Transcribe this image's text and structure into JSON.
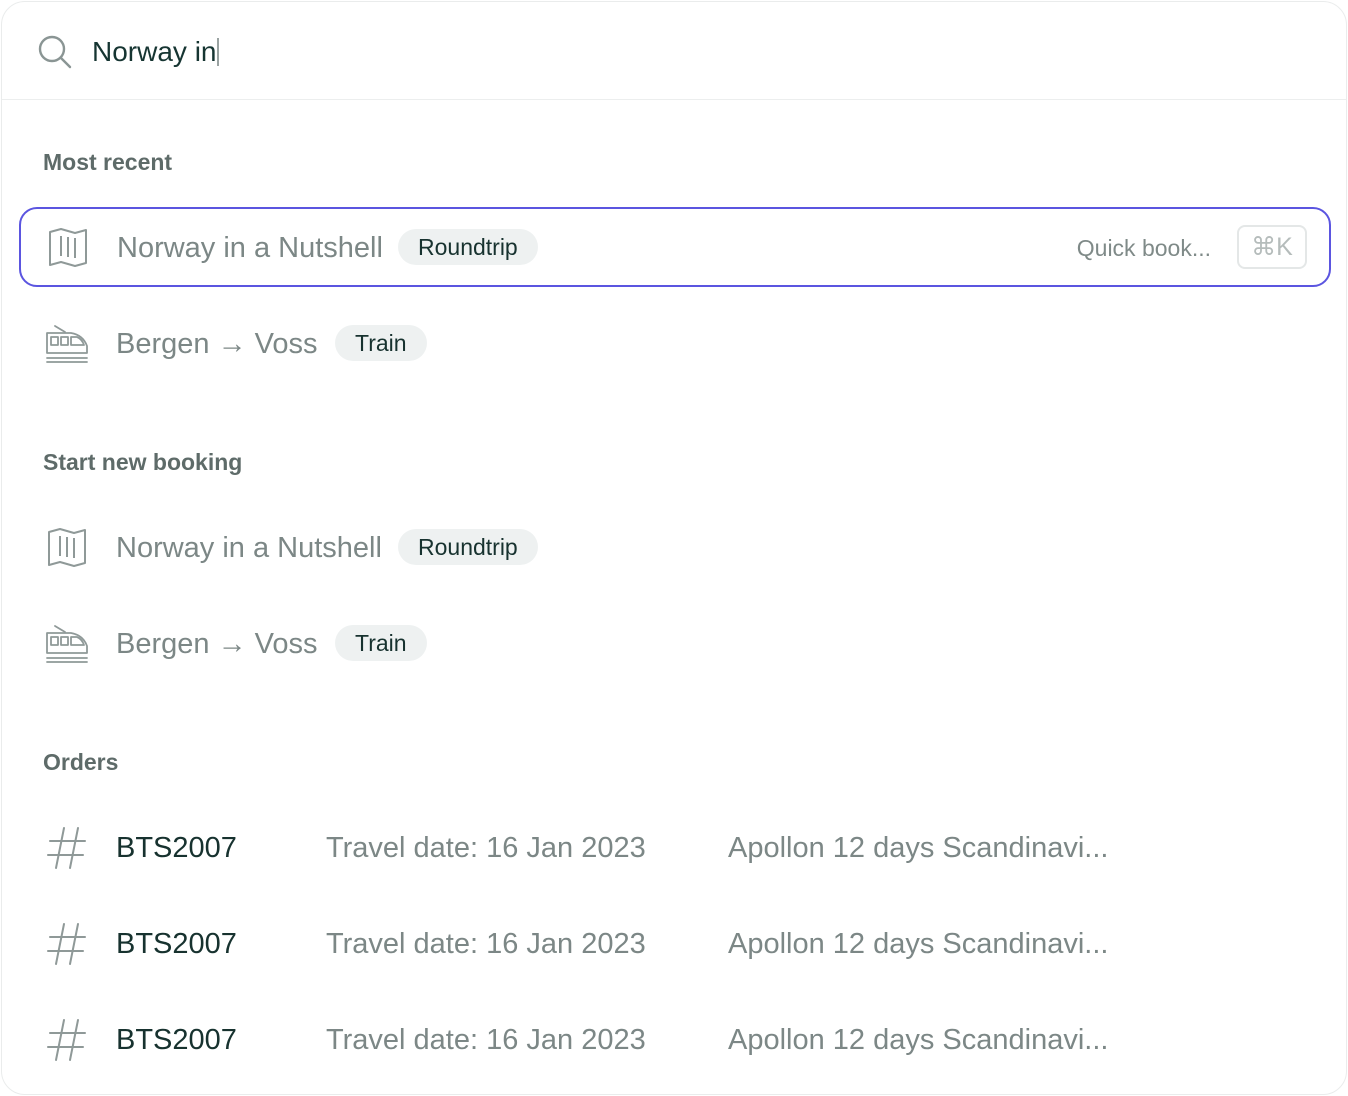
{
  "search": {
    "value": "Norway in",
    "icon": "search-icon"
  },
  "sections": {
    "recent_title": "Most recent",
    "new_booking_title": "Start new booking",
    "orders_title": "Orders"
  },
  "recent": [
    {
      "icon": "map-icon",
      "label": "Norway in a Nutshell",
      "badge": "Roundtrip",
      "selected": true,
      "hint": "Quick book...",
      "shortcut": "⌘K"
    },
    {
      "icon": "train-icon",
      "label": "Bergen → Voss",
      "badge": "Train",
      "selected": false
    }
  ],
  "new_booking": [
    {
      "icon": "map-icon",
      "label": "Norway in a Nutshell",
      "badge": "Roundtrip"
    },
    {
      "icon": "train-icon",
      "label": "Bergen → Voss",
      "badge": "Train"
    }
  ],
  "orders": [
    {
      "icon": "hash-icon",
      "id": "BTS2007",
      "date": "Travel date: 16 Jan 2023",
      "description": "Apollon 12 days Scandinavi..."
    },
    {
      "icon": "hash-icon",
      "id": "BTS2007",
      "date": "Travel date: 16 Jan 2023",
      "description": "Apollon 12 days Scandinavi..."
    },
    {
      "icon": "hash-icon",
      "id": "BTS2007",
      "date": "Travel date: 16 Jan 2023",
      "description": "Apollon 12 days Scandinavi..."
    }
  ],
  "colors": {
    "accent": "#5b55e0",
    "text_primary": "#17322f",
    "text_muted": "#7c8786",
    "badge_bg": "#eef1f1"
  }
}
